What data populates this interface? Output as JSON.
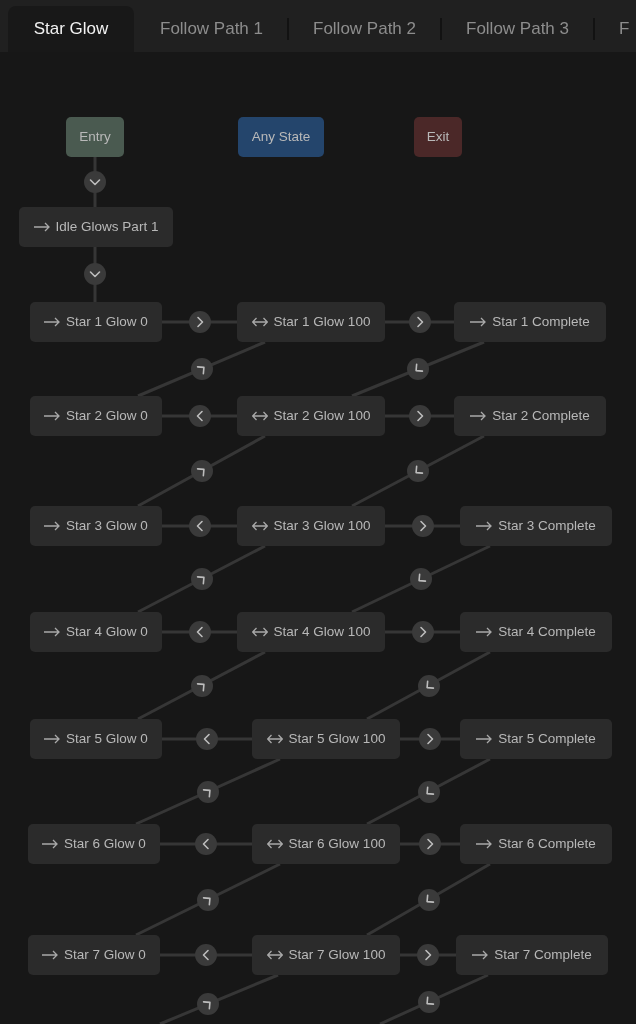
{
  "tabs": [
    {
      "label": "Star Glow",
      "selected": true
    },
    {
      "label": "Follow Path 1",
      "selected": false
    },
    {
      "label": "Follow Path 2",
      "selected": false
    },
    {
      "label": "Follow Path 3",
      "selected": false
    },
    {
      "label": "F",
      "selected": false
    }
  ],
  "special_states": [
    {
      "label": "Entry",
      "color": "#4a5a50"
    },
    {
      "label": "Any State",
      "color": "#24456c"
    },
    {
      "label": "Exit",
      "color": "#4b2828"
    }
  ],
  "entry_link": {
    "kind": "down"
  },
  "default_state": {
    "label": "Idle Glows Part 1",
    "kind": "single"
  },
  "default_link": {
    "kind": "down"
  },
  "rows": [
    {
      "states": [
        {
          "label": "Star 1 Glow 0",
          "kind": "single"
        },
        {
          "label": "Star 1 Glow 100",
          "kind": "double"
        },
        {
          "label": "Star 1 Complete",
          "kind": "single"
        }
      ],
      "links": [
        {
          "kind": "right"
        },
        {
          "kind": "right"
        },
        {
          "kind": "up"
        },
        {
          "kind": "down"
        }
      ]
    },
    {
      "states": [
        {
          "label": "Star 2 Glow 0",
          "kind": "single"
        },
        {
          "label": "Star 2 Glow 100",
          "kind": "double"
        },
        {
          "label": "Star 2 Complete",
          "kind": "single"
        }
      ],
      "links": [
        {
          "kind": "left"
        },
        {
          "kind": "right"
        },
        {
          "kind": "up"
        },
        {
          "kind": "down"
        }
      ]
    },
    {
      "states": [
        {
          "label": "Star 3 Glow 0",
          "kind": "single"
        },
        {
          "label": "Star 3 Glow 100",
          "kind": "double"
        },
        {
          "label": "Star 3 Complete",
          "kind": "single"
        }
      ],
      "links": [
        {
          "kind": "left"
        },
        {
          "kind": "right"
        },
        {
          "kind": "up"
        },
        {
          "kind": "down"
        }
      ]
    },
    {
      "states": [
        {
          "label": "Star 4 Glow 0",
          "kind": "single"
        },
        {
          "label": "Star 4 Glow 100",
          "kind": "double"
        },
        {
          "label": "Star 4 Complete",
          "kind": "single"
        }
      ],
      "links": [
        {
          "kind": "left"
        },
        {
          "kind": "right"
        },
        {
          "kind": "up"
        },
        {
          "kind": "down"
        }
      ]
    },
    {
      "states": [
        {
          "label": "Star 5 Glow 0",
          "kind": "single"
        },
        {
          "label": "Star 5 Glow 100",
          "kind": "double"
        },
        {
          "label": "Star 5 Complete",
          "kind": "single"
        }
      ],
      "links": [
        {
          "kind": "left"
        },
        {
          "kind": "right"
        },
        {
          "kind": "up"
        },
        {
          "kind": "down"
        }
      ]
    },
    {
      "states": [
        {
          "label": "Star 6 Glow 0",
          "kind": "single"
        },
        {
          "label": "Star 6 Glow 100",
          "kind": "double"
        },
        {
          "label": "Star 6 Complete",
          "kind": "single"
        }
      ],
      "links": [
        {
          "kind": "left"
        },
        {
          "kind": "right"
        },
        {
          "kind": "up"
        },
        {
          "kind": "down"
        }
      ]
    },
    {
      "states": [
        {
          "label": "Star 7 Glow 0",
          "kind": "single"
        },
        {
          "label": "Star 7 Glow 100",
          "kind": "double"
        },
        {
          "label": "Star 7 Complete",
          "kind": "single"
        }
      ],
      "links": [
        {
          "kind": "left"
        },
        {
          "kind": "right"
        },
        {
          "kind": "up"
        },
        {
          "kind": "down"
        }
      ]
    }
  ]
}
